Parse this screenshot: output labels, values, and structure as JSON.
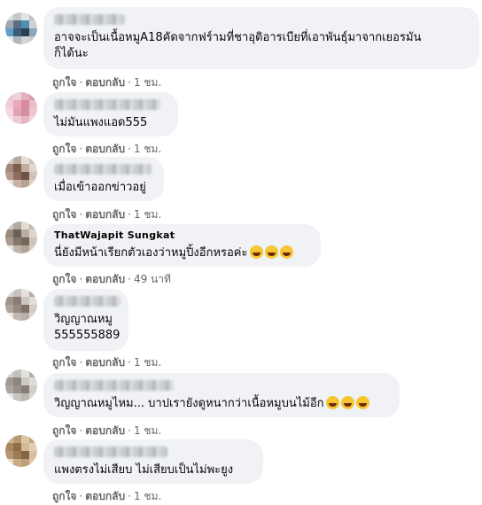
{
  "comments": [
    {
      "text": "อาจจะเป็นเนื้อหมูA18คัดจากฟร์ามที่ชาอุดิอารเบียที่เอาพันธุ์มาจากเยอรมัน\nก็ได้นะ",
      "emoji_count": 0,
      "like": "ถูกใจ",
      "reply": "ตอบกลับ",
      "time": "1 ชม.",
      "avatar_colors": [
        "#d9dadc",
        "#c5c7ca",
        "#e3e4e6",
        "#bfc1c4",
        "#a3a7ad",
        "#5a6f86",
        "#4e8fb3",
        "#cfd1d4",
        "#5fa0c6",
        "#3c5d7a",
        "#2d3f52",
        "#8aa6bd",
        "#e6e7e9",
        "#b0b5bb",
        "#d3d5d8",
        "#c8cacd"
      ]
    },
    {
      "text": "ไม่มันแพงแอด555",
      "emoji_count": 0,
      "like": "ถูกใจ",
      "reply": "ตอบกลับ",
      "time": "1 ชม.",
      "avatar_colors": [
        "#e8c6cf",
        "#f0d2da",
        "#e2b1bf",
        "#d99aae",
        "#f2cdd7",
        "#e7a9bb",
        "#d98aa1",
        "#ebbdc9",
        "#f3d9df",
        "#e3a2b5",
        "#d28fa3",
        "#edc4cf",
        "#f5e3e7",
        "#eccbd3",
        "#e4b6c2",
        "#f1d6dd"
      ]
    },
    {
      "text": "เมื่อเข้าออกข่าวอยู่",
      "emoji_count": 0,
      "like": "ถูกใจ",
      "reply": "ตอบกลับ",
      "time": "",
      "avatar_colors": [
        "#d8cdc5",
        "#b9a89c",
        "#e5ddd6",
        "#cfc3ba",
        "#a4897a",
        "#7b5f52",
        "#c2ad9f",
        "#e0d6cf",
        "#b49a8c",
        "#8d6f60",
        "#6e5446",
        "#d2c1b5",
        "#e9e2dc",
        "#c7b4a7",
        "#b8a192",
        "#ddd2ca"
      ]
    },
    {
      "name_partial": "ThatWajapit Sungkat",
      "text": "นี่ยังมีหน้าเรียกตัวเองว่าหมูปิ้งอีกหรอค่ะ",
      "emoji_count": 3,
      "like": "ถูกใจ",
      "reply": "ตอบกลับ",
      "time": "49 นาที",
      "avatar_colors": [
        "#cfc7c0",
        "#b4a99f",
        "#e2dcd6",
        "#c4b9af",
        "#9a8a7e",
        "#6f6055",
        "#bcae a2",
        "#ddd6cf",
        "#a99b8f",
        "#85766b",
        "#766559",
        "#cdc3ba",
        "#e6e1dc",
        "#bfb4aa",
        "#b1a498",
        "#d6cec7"
      ]
    },
    {
      "text": "วิญญาณหมู\n555555889",
      "emoji_count": 0,
      "like": "ถูกใจ",
      "reply": "ตอบกลับ",
      "time": "1 ชม.",
      "avatar_colors": [
        "#dad4d1",
        "#c9c0bb",
        "#e6e1de",
        "#b7aca6",
        "#a2948d",
        "#8a7b74",
        "#cfc6c1",
        "#e2dcd9",
        "#b1a49d",
        "#978880",
        "#7f6f68",
        "#d3cbc6",
        "#ebe7e5",
        "#c3b8b2",
        "#baaea8",
        "#ddd7d4"
      ]
    },
    {
      "text": "วิญญาณหมูไหม... บาปเรายังดูหนากว่าเนื้อหมูบนไม้อีก",
      "emoji_count": 3,
      "like": "ถูกใจ",
      "reply": "ตอบกลับ",
      "time": "1 ชม.",
      "avatar_colors": [
        "#d6d3cf",
        "#c3bfba",
        "#e4e2df",
        "#b2ada7",
        "#a09a93",
        "#8d867f",
        "#cdc9c4",
        "#dedbd8",
        "#aba59f",
        "#98918a",
        "#857d76",
        "#d1cdc9",
        "#e8e6e4",
        "#c7c3be",
        "#bbb6b0",
        "#dad7d3"
      ]
    },
    {
      "text": "แพงตรงไม่เสียบ ไม่เสียบเป็นไม่พะยูง",
      "emoji_count": 0,
      "like": "ถูกใจ",
      "reply": "ตอบกลับ",
      "time": "1 ชม.",
      "avatar_colors": [
        "#cfb48f",
        "#b89a73",
        "#dcc6a7",
        "#c2a57f",
        "#a9885f",
        "#8f6f48",
        "#d3ba97",
        "#e2cfb4",
        "#b59672",
        "#9c7b55",
        "#86663f",
        "#d8c1a1",
        "#e8d9c4",
        "#c7ac88",
        "#bd9f7a",
        "#dec9ad"
      ]
    }
  ]
}
